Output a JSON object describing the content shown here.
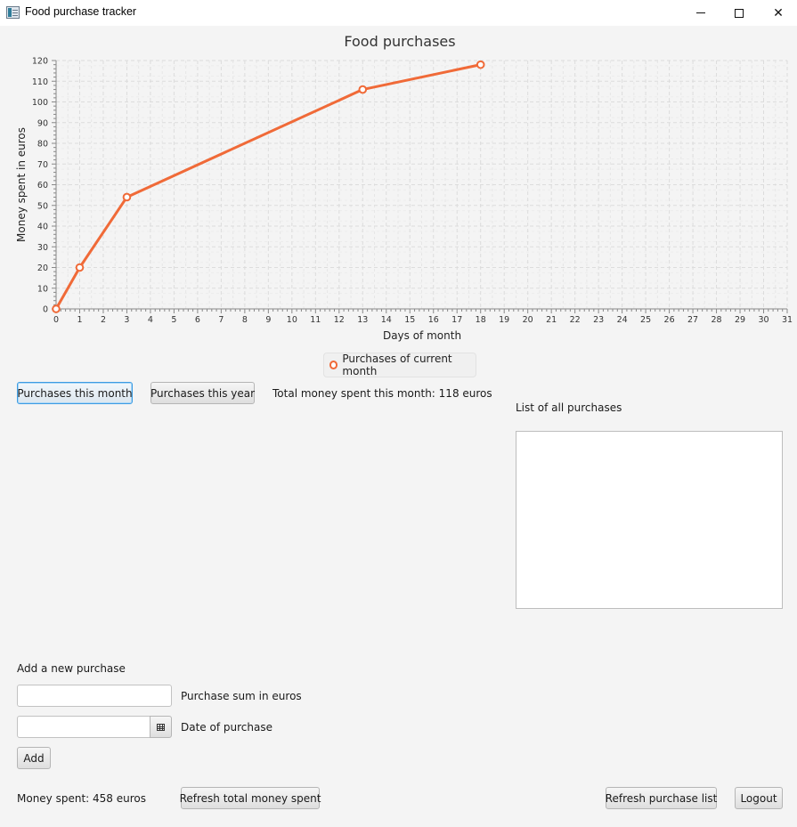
{
  "window": {
    "title": "Food purchase tracker",
    "minimize_icon": "minimize-icon",
    "maximize_icon": "maximize-icon",
    "close_icon": "close-icon"
  },
  "chart_data": {
    "type": "line",
    "title": "Food purchases",
    "xlabel": "Days of month",
    "ylabel": "Money spent in euros",
    "xlim": [
      0,
      31
    ],
    "ylim": [
      0,
      120
    ],
    "x_ticks": [
      0,
      1,
      2,
      3,
      4,
      5,
      6,
      7,
      8,
      9,
      10,
      11,
      12,
      13,
      14,
      15,
      16,
      17,
      18,
      19,
      20,
      21,
      22,
      23,
      24,
      25,
      26,
      27,
      28,
      29,
      30,
      31
    ],
    "y_ticks": [
      0,
      10,
      20,
      30,
      40,
      50,
      60,
      70,
      80,
      90,
      100,
      110,
      120
    ],
    "grid": true,
    "legend_position": "bottom",
    "series": [
      {
        "name": "Purchases of current month",
        "color": "#f06a38",
        "x": [
          0,
          1,
          3,
          13,
          18
        ],
        "y": [
          0,
          20,
          54,
          106,
          118
        ]
      }
    ]
  },
  "buttons": {
    "this_month": "Purchases this month",
    "this_year": "Purchases this year",
    "add": "Add",
    "refresh_total": "Refresh total money spent",
    "refresh_list": "Refresh purchase list",
    "logout": "Logout"
  },
  "labels": {
    "total_month": "Total money spent this month: 118 euros",
    "list_title": "List of all purchases",
    "add_title": "Add a new purchase",
    "sum_field": "Purchase sum in euros",
    "date_field": "Date of purchase",
    "money_spent": "Money spent: 458 euros"
  },
  "inputs": {
    "sum_value": "",
    "date_value": "",
    "calendar_icon": "calendar-icon"
  }
}
